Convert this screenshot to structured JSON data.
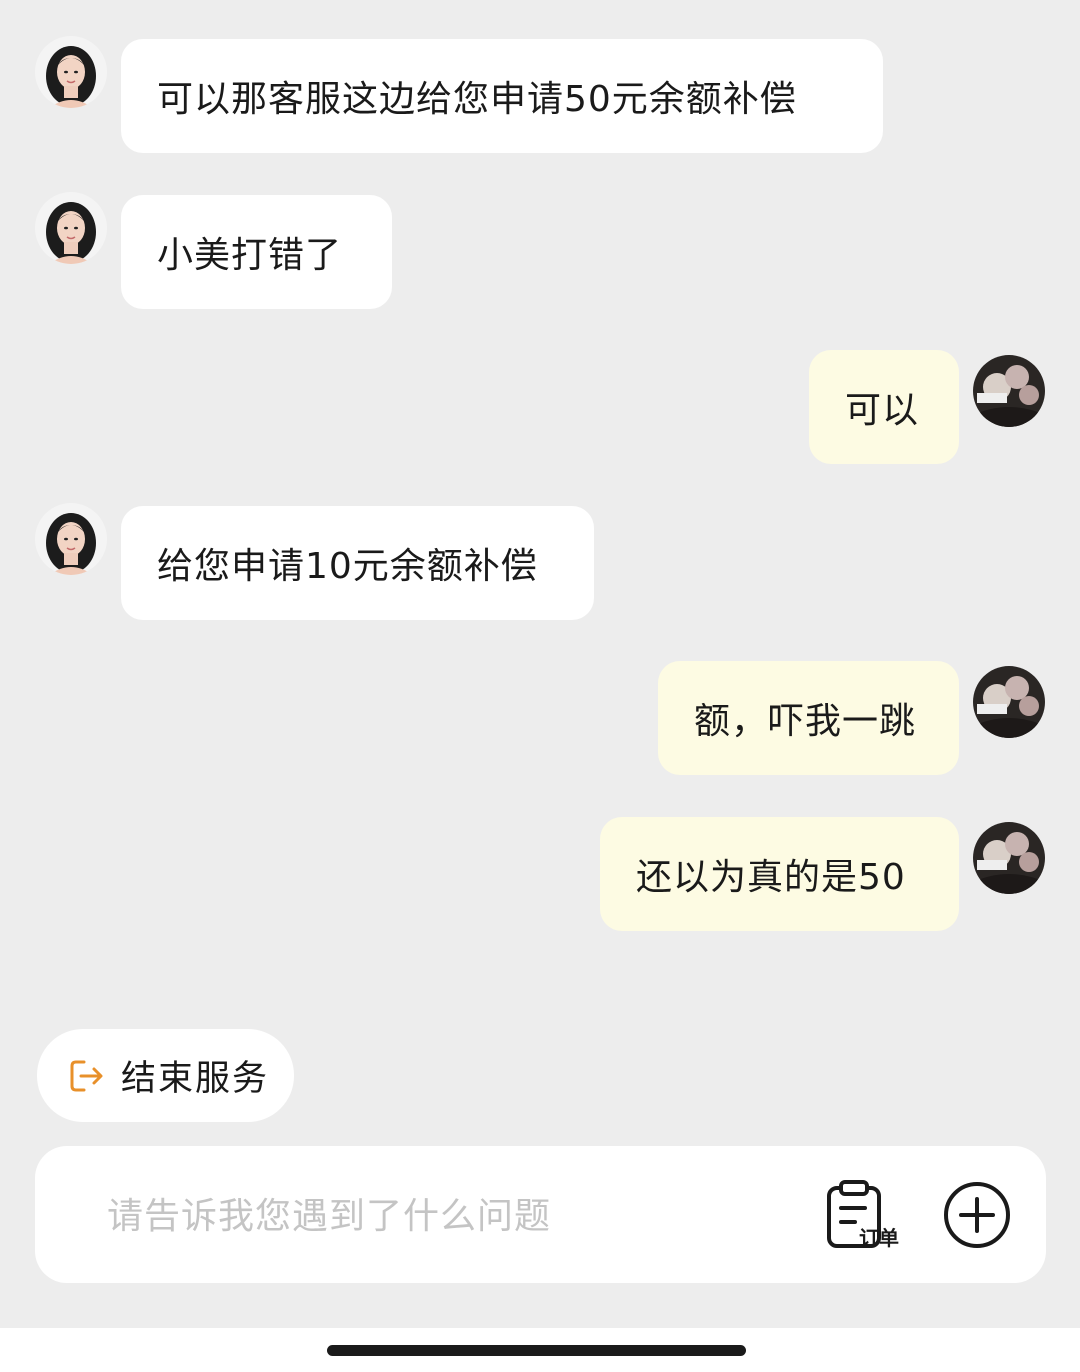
{
  "colors": {
    "background": "#ededed",
    "agent_bubble": "#ffffff",
    "user_bubble": "#fdfbe3",
    "accent": "#e8902a"
  },
  "messages": [
    {
      "from": "agent",
      "text": "可以那客服这边给您申请50元余额补偿"
    },
    {
      "from": "agent",
      "text": "小美打错了"
    },
    {
      "from": "user",
      "text": "可以"
    },
    {
      "from": "agent",
      "text": "给您申请10元余额补偿"
    },
    {
      "from": "user",
      "text": "额，吓我一跳"
    },
    {
      "from": "user",
      "text": "还以为真的是50"
    }
  ],
  "quick_action": {
    "label": "结束服务",
    "icon": "exit-icon"
  },
  "composer": {
    "placeholder": "请告诉我您遇到了什么问题",
    "value": "",
    "order_label": "订单",
    "order_icon": "clipboard-icon",
    "add_icon": "plus-circle-icon"
  }
}
